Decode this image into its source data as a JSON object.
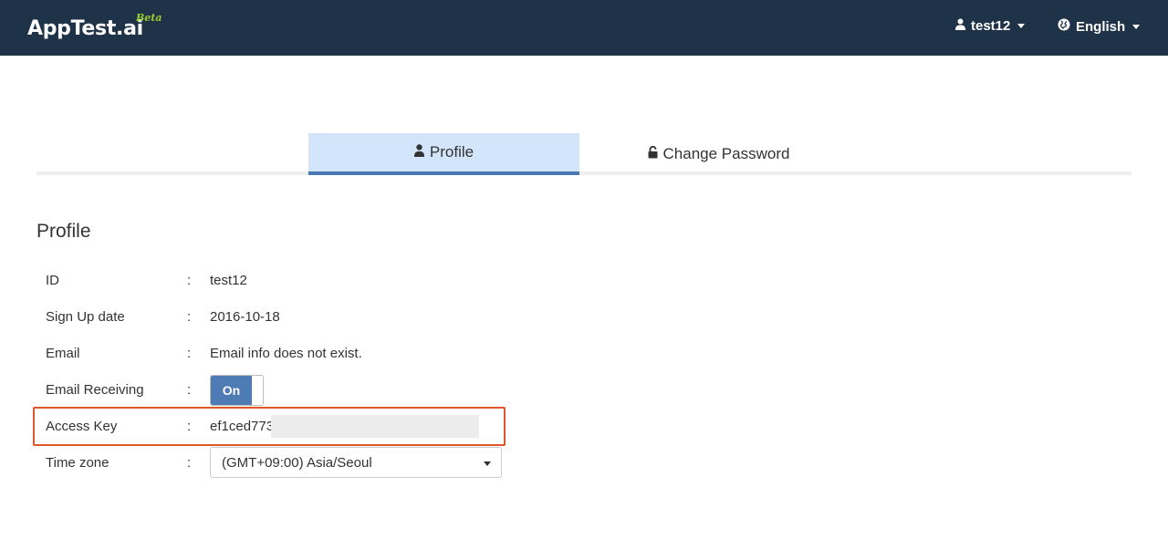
{
  "navbar": {
    "brand_main": "AppTest.",
    "brand_ai": "ai",
    "brand_beta": "Beta",
    "user_label": "test12",
    "user_icon": "user-icon",
    "language_label": "English",
    "language_icon": "globe-icon"
  },
  "tabs": [
    {
      "label": "Profile",
      "icon": "user-icon",
      "active": true
    },
    {
      "label": "Change Password",
      "icon": "unlock-icon",
      "active": false
    }
  ],
  "profile": {
    "title": "Profile",
    "fields": {
      "id": {
        "label": "ID",
        "value": "test12"
      },
      "signup": {
        "label": "Sign Up date",
        "value": "2016-10-18"
      },
      "email": {
        "label": "Email",
        "value": "Email info does not exist."
      },
      "email_receiving": {
        "label": "Email Receiving",
        "value": "On"
      },
      "access_key": {
        "label": "Access Key",
        "value": "ef1ced773"
      },
      "timezone": {
        "label": "Time zone",
        "value": "(GMT+09:00) Asia/Seoul"
      }
    },
    "separator": ":"
  },
  "colors": {
    "navbar_bg": "#1e3347",
    "beta": "#9acd32",
    "tab_active_bg": "#d3e5fb",
    "tab_active_border": "#4a78b5",
    "toggle_on": "#4f7bb5",
    "highlight": "#e0562a"
  }
}
